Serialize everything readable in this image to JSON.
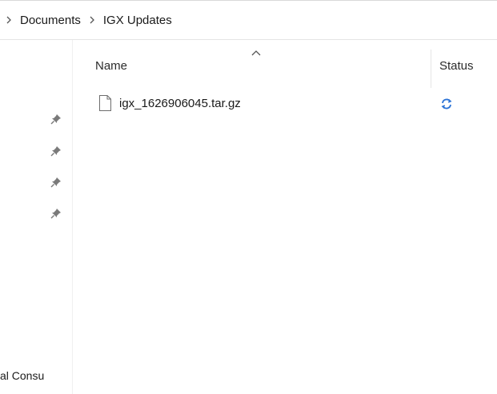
{
  "breadcrumb": {
    "items": [
      "Documents",
      "IGX Updates"
    ]
  },
  "nav": {
    "pinned_count": 4,
    "partial_label": "al Consu"
  },
  "columns": {
    "name": "Name",
    "status": "Status",
    "sort_direction": "ascending"
  },
  "files": [
    {
      "name": "igx_1626906045.tar.gz",
      "icon": "file-icon",
      "status_icon": "sync-pending-icon"
    }
  ],
  "colors": {
    "sync_blue": "#2b73d6",
    "pin_gray": "#7a7a7a",
    "divider": "#e5e5e5"
  }
}
